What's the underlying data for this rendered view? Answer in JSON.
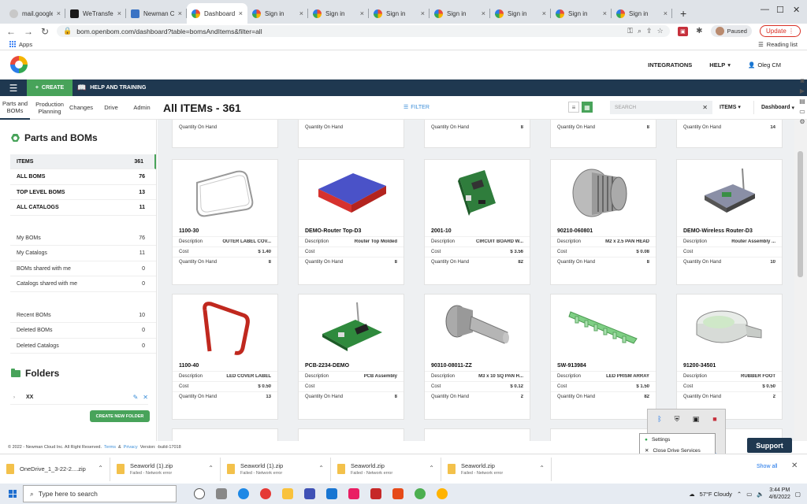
{
  "browser": {
    "tabs": [
      {
        "label": "mail.google.",
        "icon": "gmail-icon"
      },
      {
        "label": "WeTransfer",
        "icon": "wetransfer-icon"
      },
      {
        "label": "Newman Cl",
        "icon": "newman-icon"
      },
      {
        "label": "Dashboard",
        "icon": "openbom-icon",
        "active": true
      },
      {
        "label": "Sign in",
        "icon": "openbom-icon"
      },
      {
        "label": "Sign in",
        "icon": "openbom-icon"
      },
      {
        "label": "Sign in",
        "icon": "openbom-icon"
      },
      {
        "label": "Sign in",
        "icon": "openbom-icon"
      },
      {
        "label": "Sign in",
        "icon": "openbom-icon"
      },
      {
        "label": "Sign in",
        "icon": "openbom-icon"
      },
      {
        "label": "Sign in",
        "icon": "openbom-icon"
      }
    ],
    "url": "bom.openbom.com/dashboard?table=bomsAndItems&filter=all",
    "paused_label": "Paused",
    "update_label": "Update",
    "bookmarks": {
      "apps": "Apps",
      "reading_list": "Reading list"
    }
  },
  "header": {
    "nav": {
      "integrations": "INTEGRATIONS",
      "help": "HELP",
      "user": "Oleg CM"
    }
  },
  "toolbar": {
    "create": "CREATE",
    "help_training": "HELP AND TRAINING"
  },
  "subtabs": [
    {
      "label": "Parts and BOMs",
      "active": true
    },
    {
      "label": "Production Planning"
    },
    {
      "label": "Changes"
    },
    {
      "label": "Drive"
    },
    {
      "label": "Admin"
    }
  ],
  "page": {
    "title": "All ITEMs - 361",
    "filter": "FILTER",
    "search_placeholder": "SEARCH",
    "items_dropdown": "ITEMS",
    "dashboard_dropdown": "Dashboard"
  },
  "sidebar": {
    "section_title": "Parts and BOMs",
    "main_items": [
      {
        "label": "ITEMS",
        "count": "361",
        "selected": true
      },
      {
        "label": "ALL BOMS",
        "count": "76"
      },
      {
        "label": "TOP LEVEL BOMS",
        "count": "13"
      },
      {
        "label": "ALL CATALOGS",
        "count": "11"
      }
    ],
    "my_items": [
      {
        "label": "My BOMs",
        "count": "76"
      },
      {
        "label": "My Catalogs",
        "count": "11"
      },
      {
        "label": "BOMs shared with me",
        "count": "0"
      },
      {
        "label": "Catalogs shared with me",
        "count": "0"
      }
    ],
    "recent_items": [
      {
        "label": "Recent BOMs",
        "count": "10"
      },
      {
        "label": "Deleted BOMs",
        "count": "0"
      },
      {
        "label": "Deleted Catalogs",
        "count": "0"
      }
    ],
    "folders_title": "Folders",
    "folders": [
      {
        "label": "XX"
      }
    ],
    "create_folder": "CREATE NEW FOLDER"
  },
  "labels": {
    "description": "Description",
    "cost": "Cost",
    "qoh": "Quantity On Hand"
  },
  "top_stub_qoh": [
    "",
    "",
    "8",
    "8",
    "14"
  ],
  "cards": [
    {
      "name": "1100-30",
      "description": "OUTER LABEL COV...",
      "cost": "$ 1.40",
      "qoh": "8",
      "icon": "outer-label-part-icon"
    },
    {
      "name": "DEMO-Router Top-D3",
      "description": "Router Top Molded",
      "cost": "",
      "qoh": "8",
      "icon": "router-top-part-icon"
    },
    {
      "name": "2001-10",
      "description": "CIRCUIT BOARD W...",
      "cost": "$ 3.56",
      "qoh": "82",
      "icon": "circuit-board-part-icon"
    },
    {
      "name": "90210-060801",
      "description": "M2 x 2.5 PAN HEAD",
      "cost": "$ 0.08",
      "qoh": "8",
      "icon": "pan-head-screw-part-icon"
    },
    {
      "name": "DEMO-Wireless Router-D3",
      "description": "Router Assembly ...",
      "cost": "",
      "qoh": "10",
      "icon": "wireless-router-part-icon"
    },
    {
      "name": "1100-40",
      "description": "LED COVER LABEL",
      "cost": "$ 0.50",
      "qoh": "13",
      "icon": "led-cover-label-part-icon"
    },
    {
      "name": "PCB-2234-DEMO",
      "description": "PCB Assembly",
      "cost": "",
      "qoh": "8",
      "icon": "pcb-assembly-part-icon"
    },
    {
      "name": "90310-08011-ZZ",
      "description": "M3 x 10 SQ PAN H...",
      "cost": "$ 0.12",
      "qoh": "2",
      "icon": "sq-pan-screw-part-icon"
    },
    {
      "name": "SW-913984",
      "description": "LED PRISM ARRAY",
      "cost": "$ 1.50",
      "qoh": "82",
      "icon": "led-prism-array-part-icon"
    },
    {
      "name": "91200-34501",
      "description": "RUBBER FOOT",
      "cost": "$ 0.50",
      "qoh": "2",
      "icon": "rubber-foot-part-icon"
    }
  ],
  "footer": {
    "copyright": "© 2022 - Newman Cloud Inc. All Right Reserved.",
    "terms": "Terms",
    "amp": "&",
    "privacy": "Privacy",
    "version": "Version: -build-17018",
    "support": "Support"
  },
  "context_menu": [
    "Settings",
    "Close Drive Services"
  ],
  "downloads": [
    {
      "name": "OneDrive_1_3-22-2....zip",
      "status": ""
    },
    {
      "name": "Seaworld (1).zip",
      "status": "Failed - Network error"
    },
    {
      "name": "Seaworld (1).zip",
      "status": "Failed - Network error"
    },
    {
      "name": "Seaworld.zip",
      "status": "Failed - Network error"
    },
    {
      "name": "Seaworld.zip",
      "status": "Failed - Network error"
    }
  ],
  "download_show_all": "Show all",
  "taskbar": {
    "search_placeholder": "Type here to search",
    "weather": "57°F  Cloudy",
    "time": "3:44 PM",
    "date": "4/6/2022"
  }
}
